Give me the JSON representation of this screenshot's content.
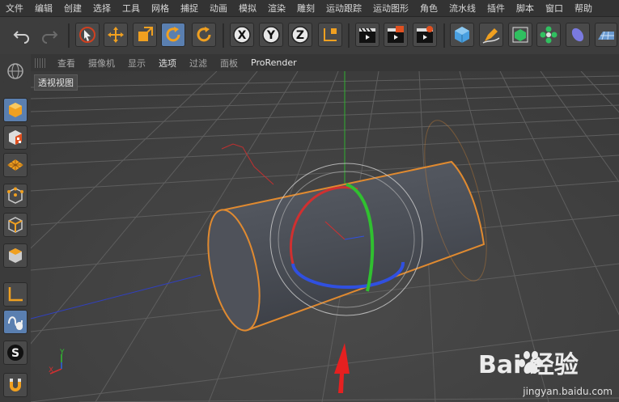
{
  "menu": [
    "文件",
    "编辑",
    "创建",
    "选择",
    "工具",
    "网格",
    "捕捉",
    "动画",
    "模拟",
    "渲染",
    "雕刻",
    "运动跟踪",
    "运动图形",
    "角色",
    "流水线",
    "插件",
    "脚本",
    "窗口",
    "帮助"
  ],
  "toolbar_icons": [
    "undo-icon",
    "redo-icon",
    "live-select-icon",
    "move-icon",
    "scale-icon",
    "rotate-icon",
    "rotate-alt-icon",
    "x-axis-icon",
    "y-axis-icon",
    "z-axis-icon",
    "coordinate-system-icon",
    "render-view-icon",
    "render-picture-viewer-icon",
    "render-settings-icon",
    "cube-icon",
    "pen-icon",
    "subdivision-icon",
    "cloner-icon",
    "deformer-icon",
    "floor-icon"
  ],
  "axis_letters": {
    "x": "X",
    "y": "Y",
    "z": "Z"
  },
  "viewport_menu": {
    "items": [
      "查看",
      "摄像机",
      "显示",
      "选项",
      "过滤",
      "面板"
    ],
    "renderer": "ProRender"
  },
  "viewport_label": "透视视图",
  "left_icons": [
    "model-mode-icon",
    "texture-mode-icon",
    "workplane-icon",
    "points-mode-icon",
    "edges-mode-icon",
    "polygons-mode-icon",
    "axis-mode-icon",
    "tweak-mode-icon",
    "solo-icon",
    "snap-icon"
  ],
  "axis_gizmo": {
    "y": "Y",
    "x": "X"
  },
  "watermark": {
    "brand": "Bai 经验",
    "url": "jingyan.baidu.com"
  },
  "colors": {
    "x_axis": "#d03030",
    "y_axis": "#30c030",
    "z_axis": "#3050e0",
    "selection": "#e08a30",
    "arrow": "#e62020"
  }
}
